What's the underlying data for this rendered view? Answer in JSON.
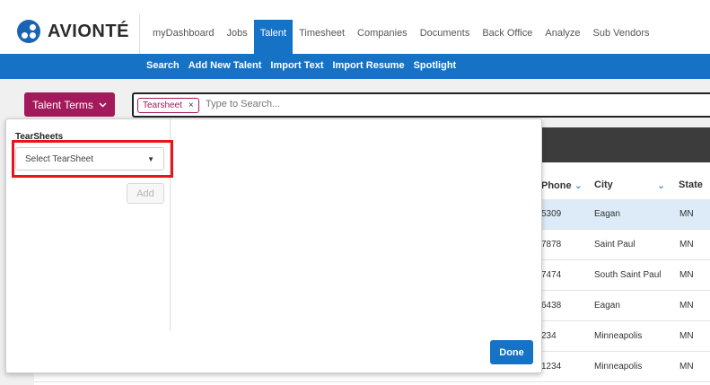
{
  "app": {
    "logo_text": "AVIONTÉ"
  },
  "topnav": {
    "items": [
      "myDashboard",
      "Jobs",
      "Talent",
      "Timesheet",
      "Companies",
      "Documents",
      "Back Office",
      "Analyze",
      "Sub Vendors"
    ],
    "active": "Talent"
  },
  "subnav": {
    "items": [
      "Search",
      "Add New Talent",
      "Import Text",
      "Import Resume",
      "Spotlight"
    ]
  },
  "search": {
    "terms_button": "Talent Terms",
    "chip_label": "Tearsheet",
    "chip_close": "×",
    "placeholder": "Type to Search..."
  },
  "panel": {
    "label": "TearSheets",
    "select_value": "Select TearSheet",
    "add_label": "Add",
    "done_label": "Done"
  },
  "table": {
    "headers": {
      "phone": "Phone",
      "city": "City",
      "state": "State"
    },
    "rows": [
      {
        "phone": "5309",
        "city": "Eagan",
        "state": "MN"
      },
      {
        "phone": "7878",
        "city": "Saint Paul",
        "state": "MN"
      },
      {
        "phone": "7474",
        "city": "South Saint Paul",
        "state": "MN"
      },
      {
        "phone": "6438",
        "city": "Eagan",
        "state": "MN"
      },
      {
        "phone": "234",
        "city": "Minneapolis",
        "state": "MN"
      },
      {
        "phone": "1234",
        "city": "Minneapolis",
        "state": "MN"
      }
    ]
  },
  "colors": {
    "brand_blue": "#1572c4",
    "accent_magenta": "#a3195b",
    "highlight_red": "#e8141b"
  }
}
